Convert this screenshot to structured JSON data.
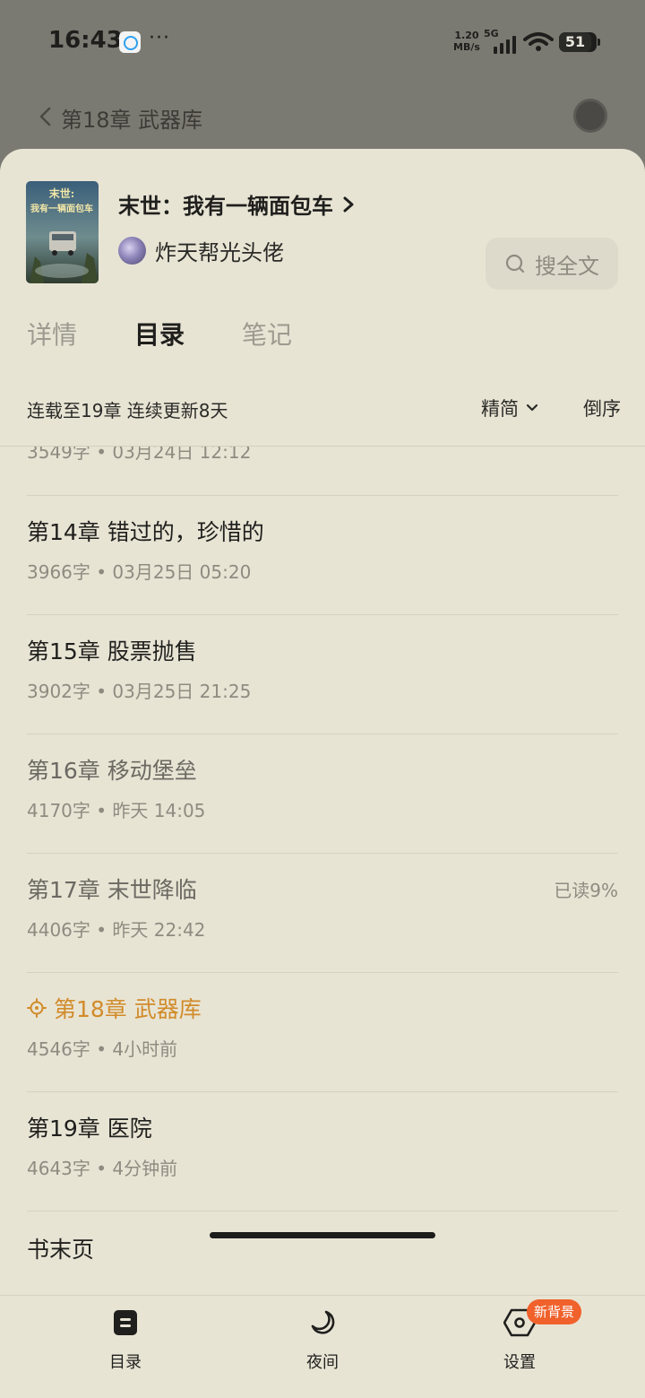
{
  "status_bar": {
    "time": "16:43",
    "more": "···",
    "net_speed_value": "1.20",
    "net_speed_unit": "MB/s",
    "network": "5G",
    "battery": "51"
  },
  "reader": {
    "title": "第18章 武器库"
  },
  "book": {
    "title": "末世：我有一辆面包车",
    "author": "炸天帮光头佬",
    "cover_text": "末世：我有一辆面包车",
    "search_label": "搜全文"
  },
  "tabs": [
    {
      "label": "详情"
    },
    {
      "label": "目录"
    },
    {
      "label": "笔记"
    }
  ],
  "toc": {
    "serial_info": "连载至19章 连续更新8天",
    "mode": "精简",
    "order": "倒序",
    "partial_meta": "3549字 • 03月24日 12:12",
    "chapters": [
      {
        "title": "第14章 错过的，珍惜的",
        "meta": "3966字 • 03月25日 05:20",
        "progress": ""
      },
      {
        "title": "第15章 股票抛售",
        "meta": "3902字 • 03月25日 21:25",
        "progress": ""
      },
      {
        "title": "第16章 移动堡垒",
        "meta": "4170字 • 昨天 14:05",
        "progress": ""
      },
      {
        "title": "第17章 末世降临",
        "meta": "4406字 • 昨天 22:42",
        "progress": "已读9%"
      },
      {
        "title": "第18章 武器库",
        "meta": "4546字 • 4小时前",
        "progress": ""
      },
      {
        "title": "第19章 医院",
        "meta": "4643字 • 4分钟前",
        "progress": ""
      }
    ],
    "end_page": "书末页"
  },
  "nav": {
    "toc_label": "目录",
    "night_label": "夜间",
    "settings_label": "设置",
    "settings_badge": "新背景"
  },
  "colors": {
    "sheet_bg": "#e8e4d4",
    "current_chapter": "#d18b2a",
    "badge": "#f0612b"
  }
}
